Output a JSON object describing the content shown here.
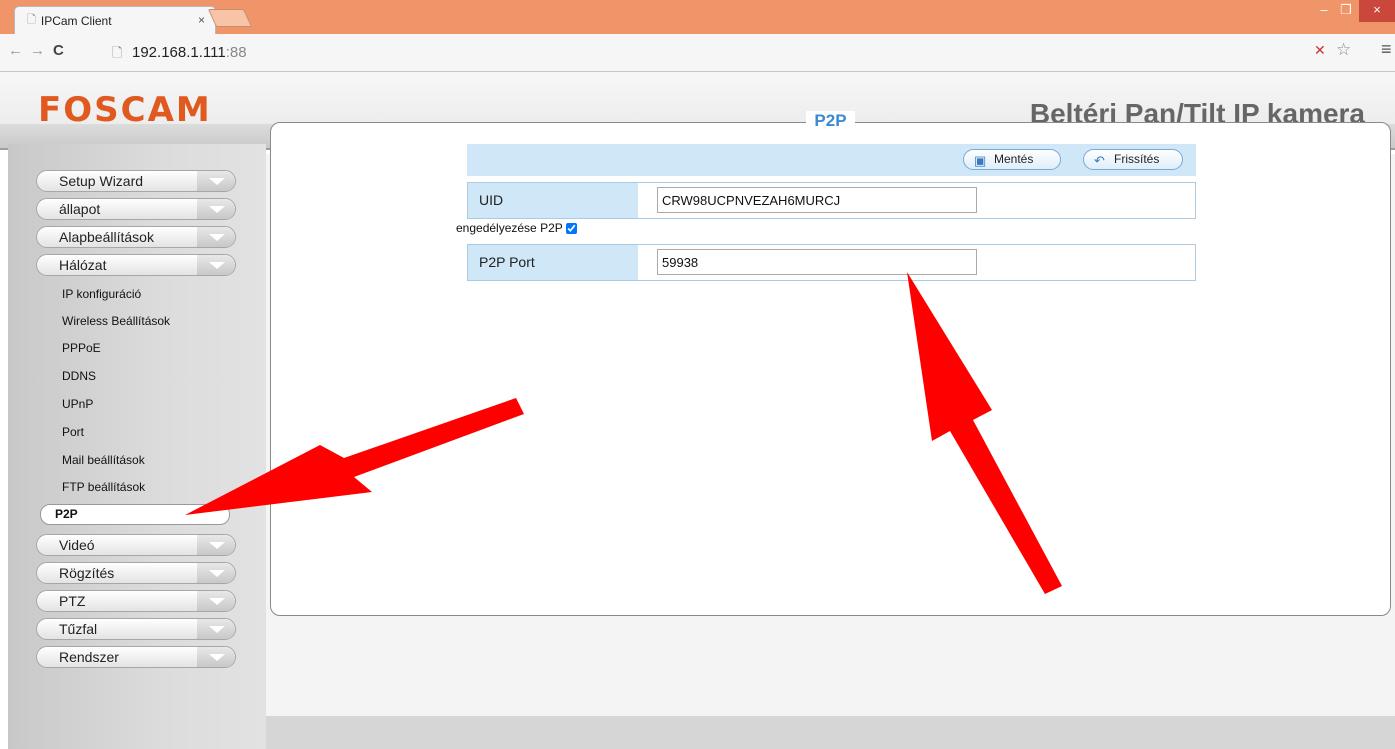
{
  "browser": {
    "tab_title": "IPCam Client",
    "tab_close": "×",
    "url_host": "192.168.1.111",
    "url_port": ":88",
    "win_min": "–",
    "win_max": "❐",
    "win_close": "×"
  },
  "header": {
    "logo": "FOSCAM",
    "camera_title": "Beltéri Pan/Tilt IP kamera"
  },
  "sidebar": {
    "menu_top": [
      "Setup Wizard",
      "állapot",
      "Alapbeállítások",
      "Hálózat"
    ],
    "network_sub": [
      "IP konfiguráció",
      "Wireless Beállítások",
      "PPPoE",
      "DDNS",
      "UPnP",
      "Port",
      "Mail beállítások",
      "FTP beállítások"
    ],
    "active_sub": "P2P",
    "menu_bottom": [
      "Videó",
      "Rögzítés",
      "PTZ",
      "Tűzfal",
      "Rendszer"
    ]
  },
  "panel": {
    "title": "P2P",
    "save_label": "Mentés",
    "refresh_label": "Frissítés",
    "uid_label": "UID",
    "uid_value": "CRW98UCPNVEZAH6MURCJ",
    "enable_label": "engedélyezése P2P",
    "enable_checked": true,
    "port_label": "P2P Port",
    "port_value": "59938"
  },
  "colors": {
    "accent": "#3b8ad2",
    "brand": "#e05a1f",
    "titlebar": "#f0956a",
    "annotation_arrow": "#ff0000"
  }
}
